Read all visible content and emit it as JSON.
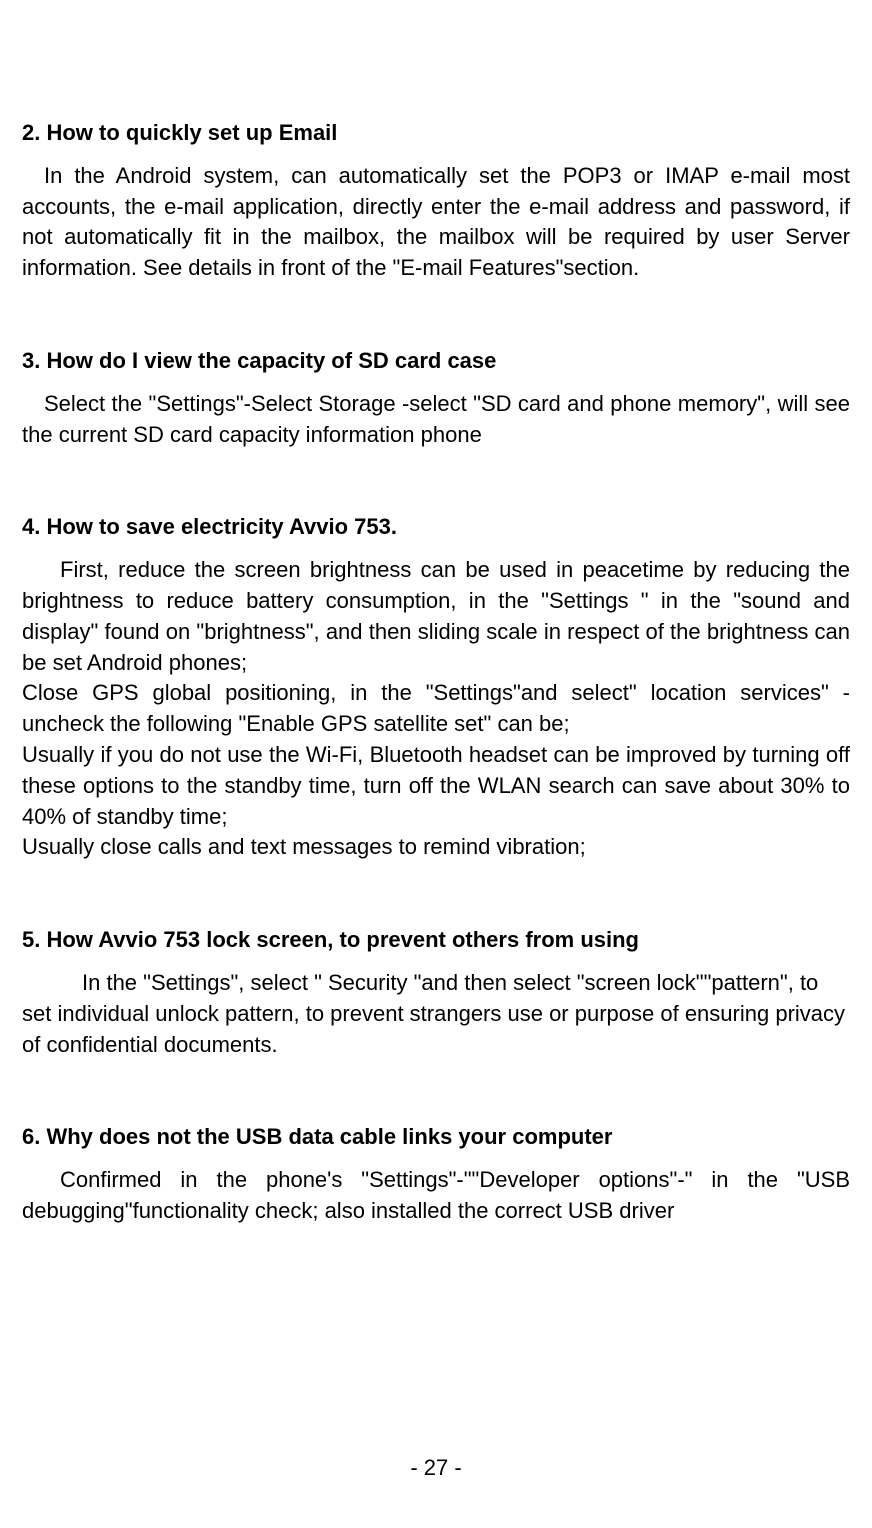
{
  "section2": {
    "heading": "2. How to quickly set up Email",
    "p1": "In the Android system, can automatically set the POP3 or IMAP e-mail most accounts, the e-mail application, directly enter the e-mail address and password, if not automatically fit in the mailbox, the mailbox will be required by user Server information. See details in front of the \"E-mail Features\"section."
  },
  "section3": {
    "heading": "3. How do I view the capacity of SD card case",
    "p1": "Select the \"Settings\"-Select Storage -select \"SD card and phone memory\", will see the current SD card capacity information phone"
  },
  "section4": {
    "heading": "4. How to save electricity Avvio 753.",
    "p1": "First, reduce the screen brightness can be used in peacetime by reducing the brightness to reduce battery consumption, in the \"Settings \" in the \"sound and display\" found on \"brightness\", and then sliding scale in respect of the brightness can be set Android phones;",
    "p2": "Close GPS global positioning, in the \"Settings\"and select\" location services\" -uncheck the following \"Enable GPS satellite set\" can be;",
    "p3": "Usually if you do not use the Wi-Fi, Bluetooth headset can be improved by turning off these options to the standby time, turn off the WLAN search can save about 30% to 40% of standby time;",
    "p4": "Usually close calls and text messages to remind vibration;"
  },
  "section5": {
    "heading": "5. How Avvio 753 lock screen, to prevent others from using",
    "p1": "In the \"Settings\", select \" Security \"and then select \"screen lock\"\"pattern\", to set individual unlock pattern, to prevent strangers use or purpose of ensuring privacy of confidential documents."
  },
  "section6": {
    "heading": "6. Why does not the USB data cable links your computer",
    "p1": "Confirmed in the phone's \"Settings\"-\"\"Developer options\"-\"   in the \"USB debugging\"functionality check; also installed the correct USB driver"
  },
  "footer": "- 27 -"
}
